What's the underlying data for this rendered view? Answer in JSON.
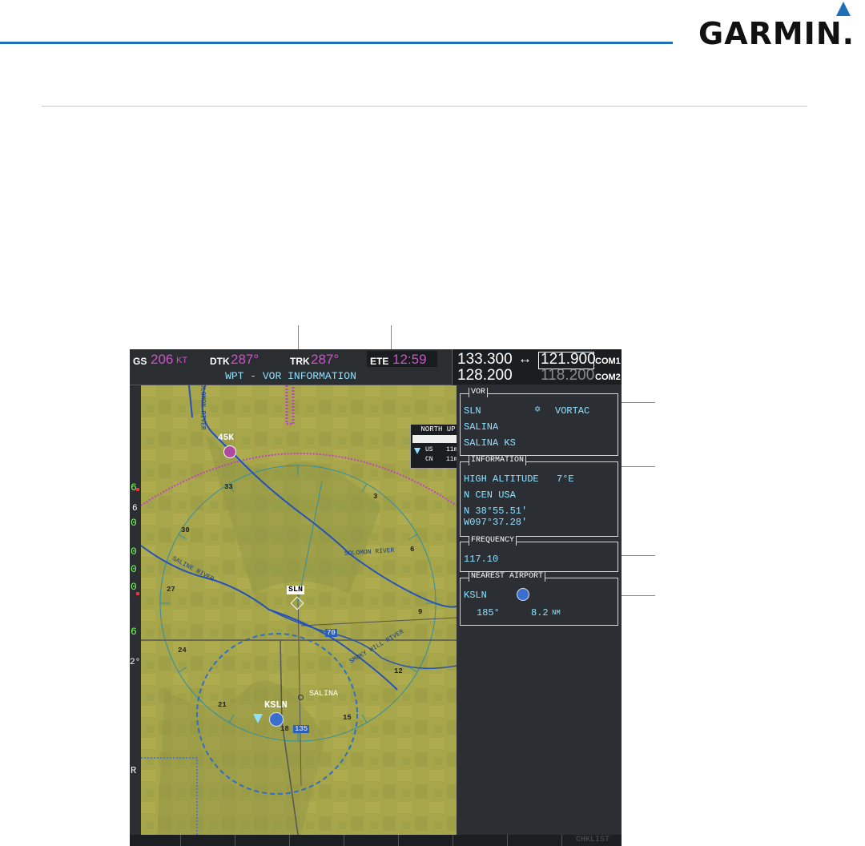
{
  "brand": {
    "name": "GARMIN."
  },
  "nav": {
    "gs_label": "GS",
    "gs_value": "206",
    "gs_unit": "KT",
    "dtk_label": "DTK",
    "dtk_value": "287°",
    "trk_label": "TRK",
    "trk_value": "287°",
    "ete_label": "ETE",
    "ete_value": "12:59",
    "page_title": "WPT - VOR INFORMATION"
  },
  "radio": {
    "active1": "133.300",
    "swap_symbol": "↔",
    "standby1": "121.900",
    "com1": "COM1",
    "active2": "128.200",
    "standby2": "118.200",
    "com2": "COM2"
  },
  "map": {
    "orientation": "NORTH UP",
    "legend": [
      {
        "label": "US",
        "value": "11m"
      },
      {
        "label": "CN",
        "value": "11m"
      }
    ],
    "scale": "30",
    "scale_unit": "NM",
    "labels": {
      "waypoint_45k": "45K",
      "vor": "SLN",
      "airport": "KSLN",
      "city": "SALINA",
      "interstate70": "70",
      "interstate135": "135",
      "river_solomon": "SOLOMON RIVER",
      "river_saline": "SALINE RIVER",
      "river_smoky": "SMOKY HILL RIVER",
      "river_north": "SOLOMON RIVER"
    },
    "compass": [
      "33",
      "30",
      "27",
      "24",
      "21",
      "18",
      "15",
      "12",
      "9",
      "6",
      "3"
    ]
  },
  "left_strip": [
    "6",
    "6",
    "0",
    "0",
    "0",
    "0",
    "6",
    "2°",
    "R"
  ],
  "vor_box": {
    "title": "VOR",
    "ident": "SLN",
    "type": "VORTAC",
    "name": "SALINA",
    "city": "SALINA KS"
  },
  "info_box": {
    "title": "INFORMATION",
    "class": "HIGH ALTITUDE",
    "mag_var": "7°E",
    "region": "N CEN USA",
    "lat": "N 38°55.51'",
    "lon": "W097°37.28'"
  },
  "freq_box": {
    "title": "FREQUENCY",
    "value": "117.10"
  },
  "nearest_box": {
    "title": "NEAREST AIRPORT",
    "ident": "KSLN",
    "bearing": "185°",
    "distance": "8.2",
    "dist_unit": "NM"
  },
  "softkeys": [
    "",
    "",
    "",
    "",
    "",
    "",
    "",
    "",
    "",
    "CHKLIST"
  ],
  "colors": {
    "map_ground": "#a8a64a",
    "map_dark": "#8f9445",
    "accent": "#1c70b8",
    "magenta": "#d04fd0",
    "cyan": "#8fe0ff"
  }
}
